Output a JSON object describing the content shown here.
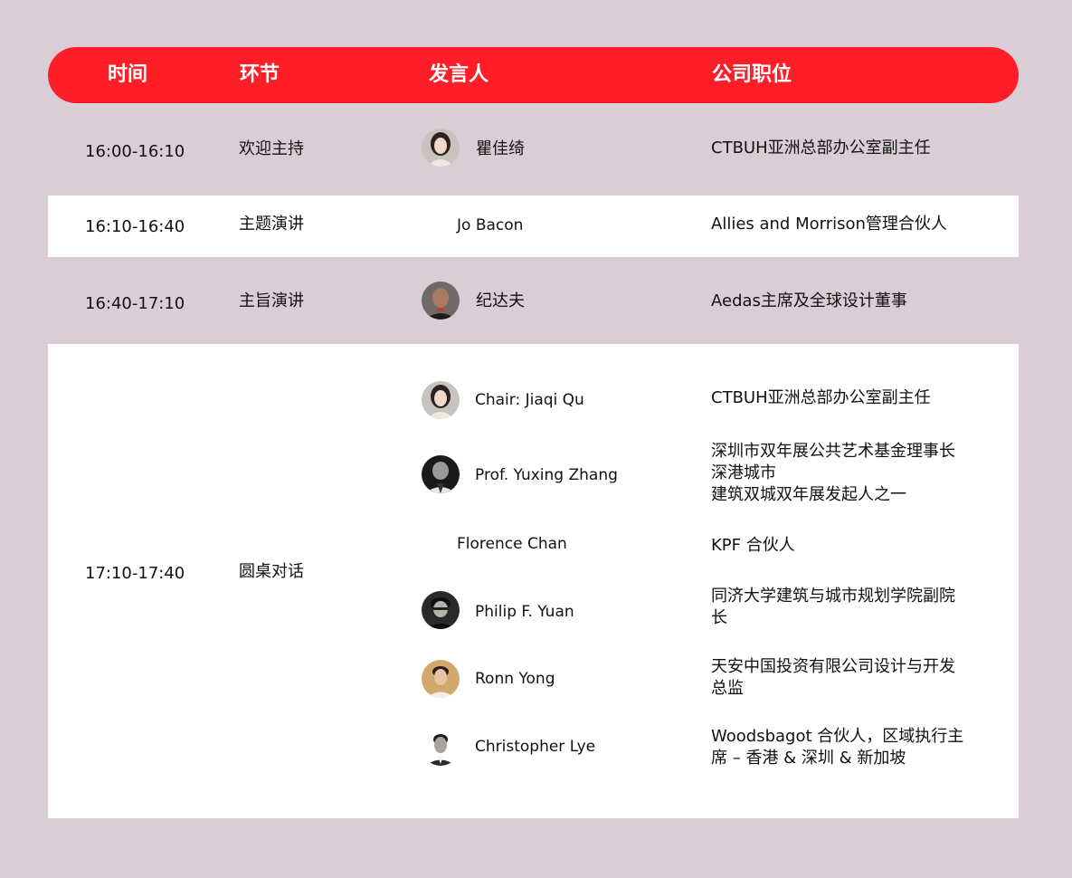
{
  "header": {
    "time": "时间",
    "section": "环节",
    "speaker": "发言人",
    "company": "公司职位"
  },
  "rows": [
    {
      "time": "16:00-16:10",
      "section": "欢迎主持",
      "speakers": [
        {
          "name": "瞿佳绮",
          "company": "CTBUH亚洲总部办公室副主任",
          "avatar": "female-portrait-avatar"
        }
      ]
    },
    {
      "time": "16:10-16:40",
      "section": "主题演讲",
      "speakers": [
        {
          "name": "Jo Bacon",
          "company": "Allies and Morrison管理合伙人"
        }
      ]
    },
    {
      "time": "16:40-17:10",
      "section": "主旨演讲",
      "speakers": [
        {
          "name": "纪达夫",
          "company": "Aedas主席及全球设计董事",
          "avatar": "male-portrait-avatar"
        }
      ]
    },
    {
      "time": "17:10-17:40",
      "section": "圆桌对话",
      "speakers": [
        {
          "name": "Chair: Jiaqi Qu",
          "company": "CTBUH亚洲总部办公室副主任",
          "avatar": "female-portrait-avatar"
        },
        {
          "name": "Prof. Yuxing Zhang",
          "company_lines": [
            "深圳市双年展公共艺术基金理事长",
            "深港城市",
            "建筑双城双年展发起人之一"
          ],
          "avatar": "male-bw-portrait-avatar"
        },
        {
          "name": "Florence Chan",
          "company": "KPF 合伙人"
        },
        {
          "name": "Philip F. Yuan",
          "company_lines": [
            "同济大学建筑与城市规划学院副院",
            "长"
          ],
          "avatar": "male-glasses-portrait-avatar"
        },
        {
          "name": "Ronn Yong",
          "company_lines": [
            "天安中国投资有限公司设计与开发",
            "总监"
          ],
          "avatar": "male-warm-portrait-avatar"
        },
        {
          "name": "Christopher Lye",
          "company_lines": [
            "Woodsbagot 合伙人，区域执行主",
            "席 – 香港 & 深圳 & 新加坡"
          ],
          "avatar": "male-suit-portrait-avatar"
        }
      ]
    }
  ],
  "colors": {
    "page_bg": "#dbcdd5",
    "header_bg": "#ff1e28",
    "row_white": "#ffffff"
  }
}
